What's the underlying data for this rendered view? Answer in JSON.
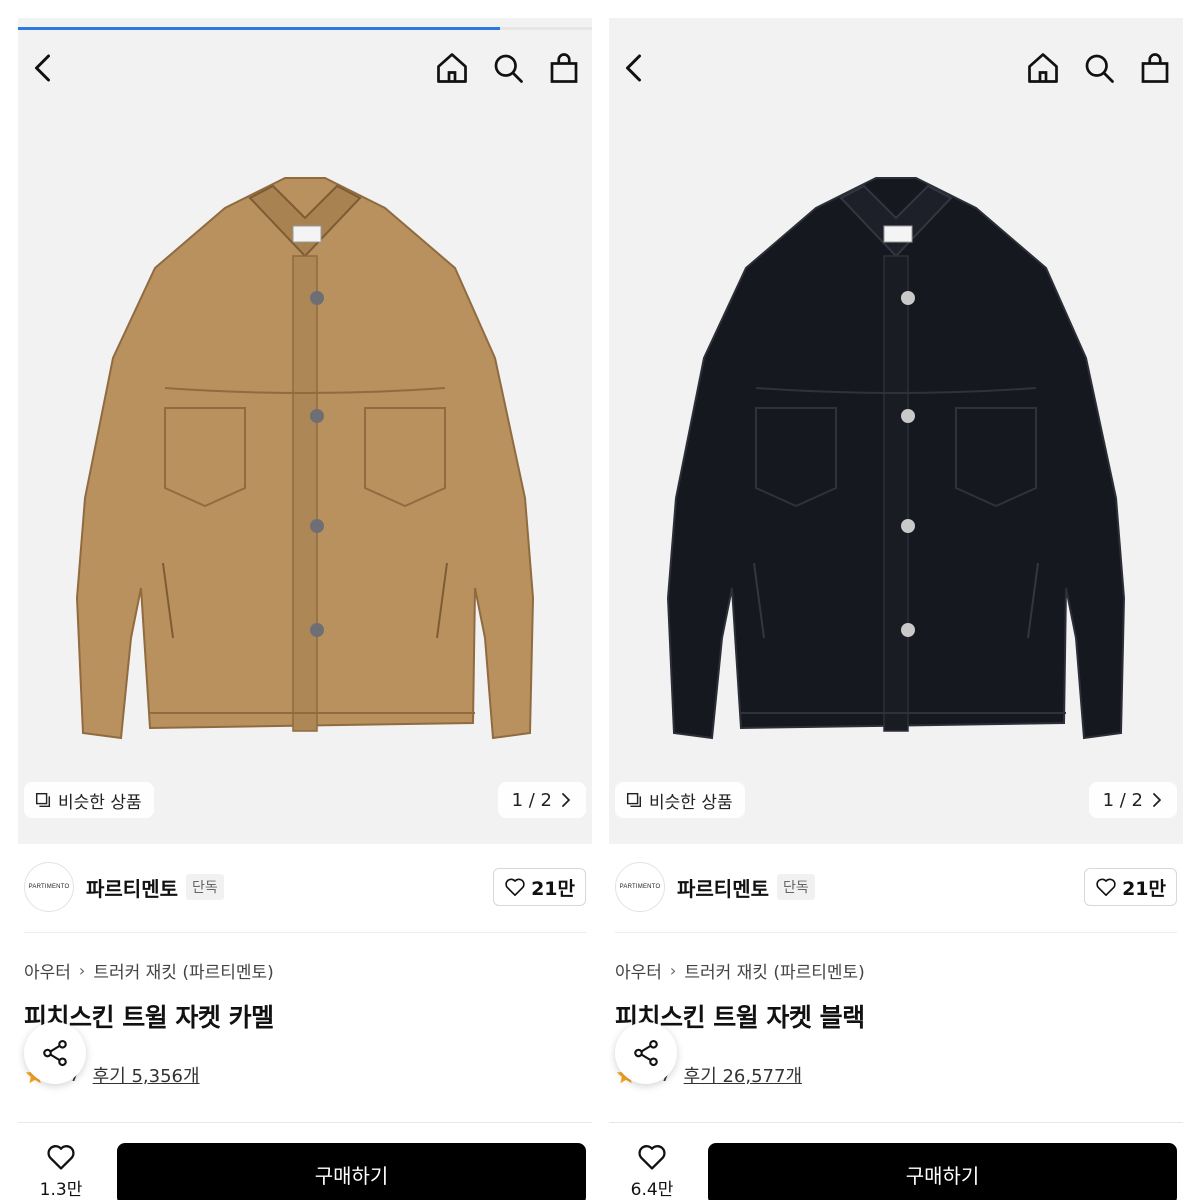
{
  "colors": {
    "accent": "#2a7ae2",
    "camel": "#b9915f",
    "black_jacket": "#16181f",
    "buy_button": "#000000",
    "star": "#f5a623"
  },
  "products": [
    {
      "progress": 0.84,
      "similar_label": "비슷한 상품",
      "pager": "1 / 2",
      "brand": {
        "logo_text": "PARTIMENTO",
        "name": "파르티멘토",
        "tag": "단독",
        "likes": "21만"
      },
      "breadcrumb": {
        "category": "아우터",
        "subcategory": "트러커 재킷 (파르티멘토)"
      },
      "title": "피치스킨 트윌 자켓 카멜",
      "rating": {
        "score": "4.7",
        "reviews": "후기 5,356개"
      },
      "wish_count": "1.3만",
      "buy_label": "구매하기",
      "jacket_color": "camel"
    },
    {
      "progress": 0,
      "similar_label": "비슷한 상품",
      "pager": "1 / 2",
      "brand": {
        "logo_text": "PARTIMENTO",
        "name": "파르티멘토",
        "tag": "단독",
        "likes": "21만"
      },
      "breadcrumb": {
        "category": "아우터",
        "subcategory": "트러커 재킷 (파르티멘토)"
      },
      "title": "피치스킨 트윌 자켓 블랙",
      "rating": {
        "score": "4.7",
        "reviews": "후기 26,577개"
      },
      "wish_count": "6.4만",
      "buy_label": "구매하기",
      "jacket_color": "black"
    }
  ],
  "icons": [
    "back-icon",
    "home-icon",
    "search-icon",
    "shopping-bag-icon",
    "similar-items-icon",
    "chevron-right-icon",
    "heart-icon",
    "share-icon",
    "star-icon"
  ]
}
